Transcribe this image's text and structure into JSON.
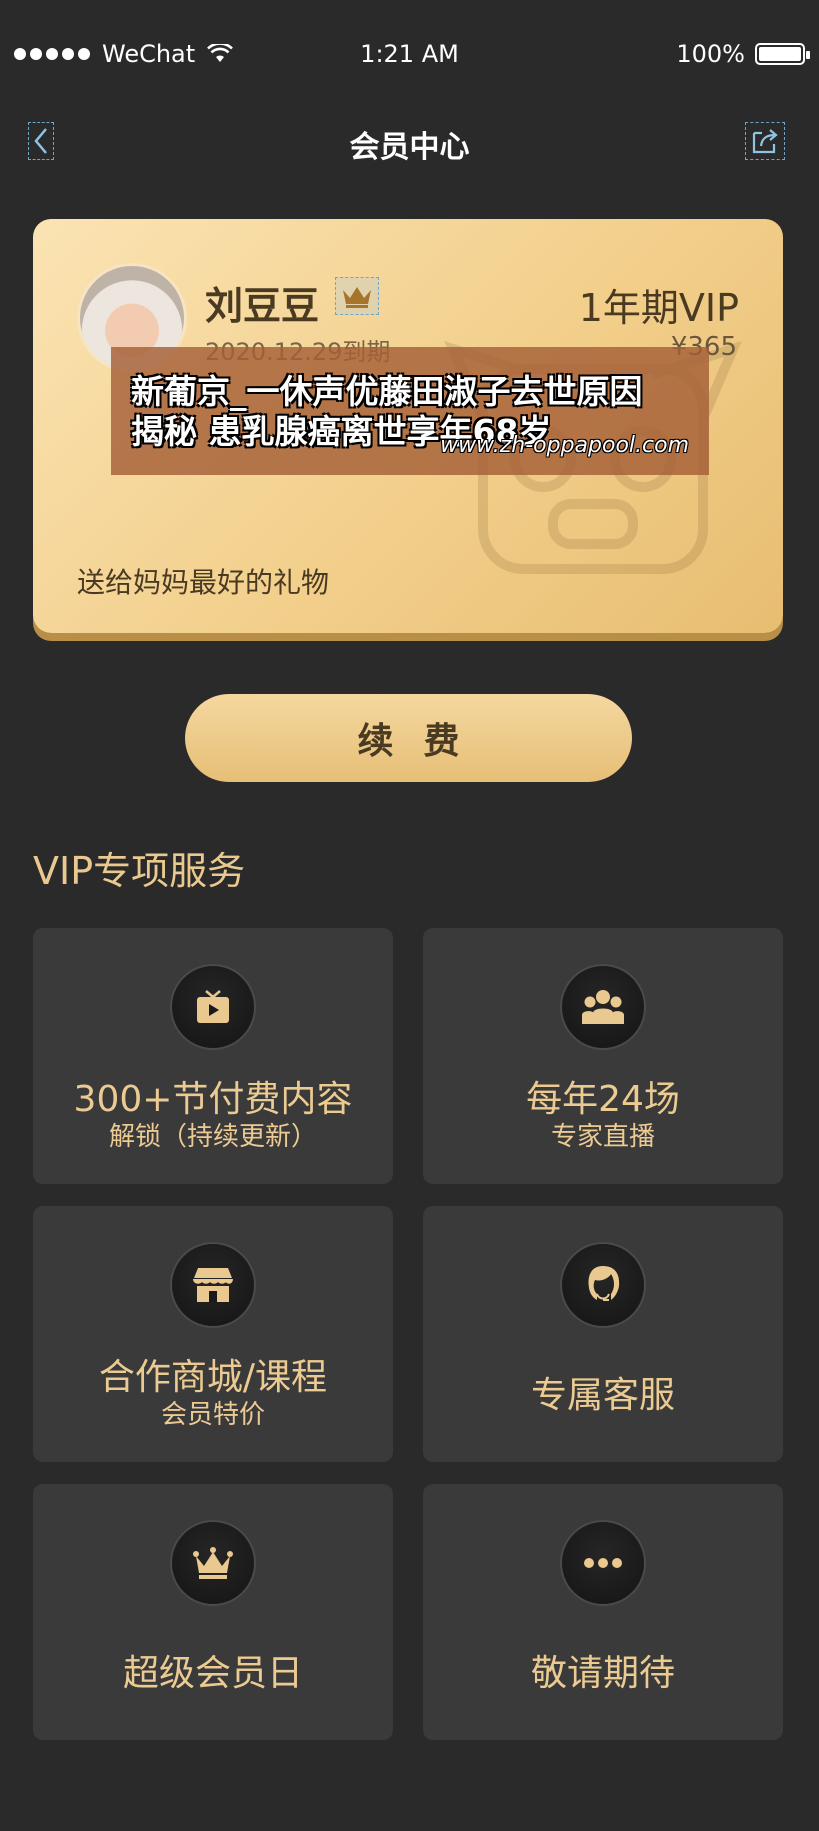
{
  "status_bar": {
    "carrier": "WeChat",
    "time": "1:21 AM",
    "battery": "100%",
    "battery_level": 1.0
  },
  "nav": {
    "title": "会员中心",
    "back_icon": "chevron-left-icon",
    "share_icon": "share-icon"
  },
  "vip_card": {
    "user_name": "刘豆豆",
    "badge_icon": "crown-icon",
    "expire_date": "2020.12.29到期",
    "plan_name": "1年期VIP",
    "plan_price": "¥365",
    "gift_text": "送给妈妈最好的礼物"
  },
  "banner": {
    "line1": "新葡京_一休声优藤田淑子去世原因",
    "line2": "揭秘 患乳腺癌离世享年68岁",
    "url": "www.zh-oppapool.com"
  },
  "renew_button": {
    "label": "续费"
  },
  "services": {
    "title": "VIP专项服务",
    "items": [
      {
        "icon": "video-icon",
        "title": "300+节付费内容",
        "subtitle": "解锁（持续更新）"
      },
      {
        "icon": "group-icon",
        "title": "每年24场",
        "subtitle": "专家直播"
      },
      {
        "icon": "shop-icon",
        "title": "合作商城/课程",
        "subtitle": "会员特价"
      },
      {
        "icon": "customer-service-icon",
        "title": "专属客服",
        "subtitle": ""
      },
      {
        "icon": "crown-icon",
        "title": "超级会员日",
        "subtitle": ""
      },
      {
        "icon": "more-icon",
        "title": "敬请期待",
        "subtitle": ""
      }
    ]
  },
  "colors": {
    "background": "#2a2a2a",
    "gold": "#e9c98f",
    "card_light": "#fbe3b3",
    "card_dark": "#e8bd72",
    "tile": "#3a3a3a"
  }
}
